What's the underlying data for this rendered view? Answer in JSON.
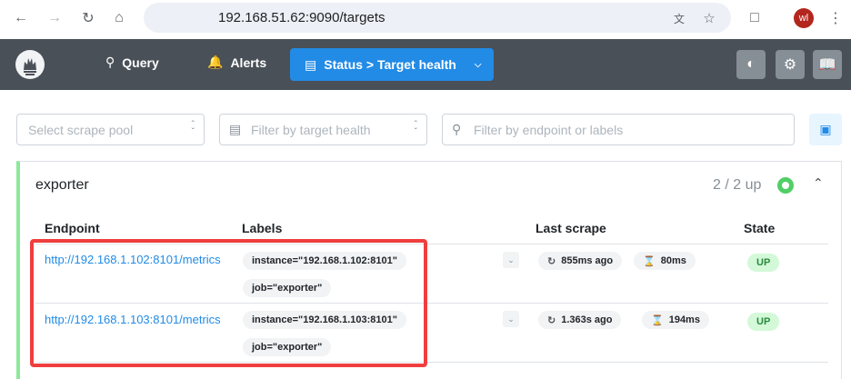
{
  "browser": {
    "url": "192.168.51.62:9090/targets",
    "avatar_initials": "wl"
  },
  "nav": {
    "query_label": "Query",
    "alerts_label": "Alerts",
    "status_label": "Status > Target health"
  },
  "filters": {
    "scrape_pool_placeholder": "Select scrape pool",
    "health_placeholder": "Filter by target health",
    "search_placeholder": "Filter by endpoint or labels"
  },
  "pool": {
    "name": "exporter",
    "count": "2 / 2 up",
    "headers": {
      "endpoint": "Endpoint",
      "labels": "Labels",
      "last_scrape": "Last scrape",
      "state": "State"
    },
    "targets": [
      {
        "endpoint": "http://192.168.1.102:8101/metrics",
        "labels": [
          "instance=\"192.168.1.102:8101\"",
          "job=\"exporter\""
        ],
        "last_scrape": "855ms ago",
        "duration": "80ms",
        "state": "UP"
      },
      {
        "endpoint": "http://192.168.1.103:8101/metrics",
        "labels": [
          "instance=\"192.168.1.103:8101\"",
          "job=\"exporter\""
        ],
        "last_scrape": "1.363s ago",
        "duration": "194ms",
        "state": "UP"
      }
    ]
  },
  "colors": {
    "navbar": "#495057",
    "accent": "#228be6",
    "healthy": "#51cf66",
    "highlight": "#f03e3e"
  }
}
